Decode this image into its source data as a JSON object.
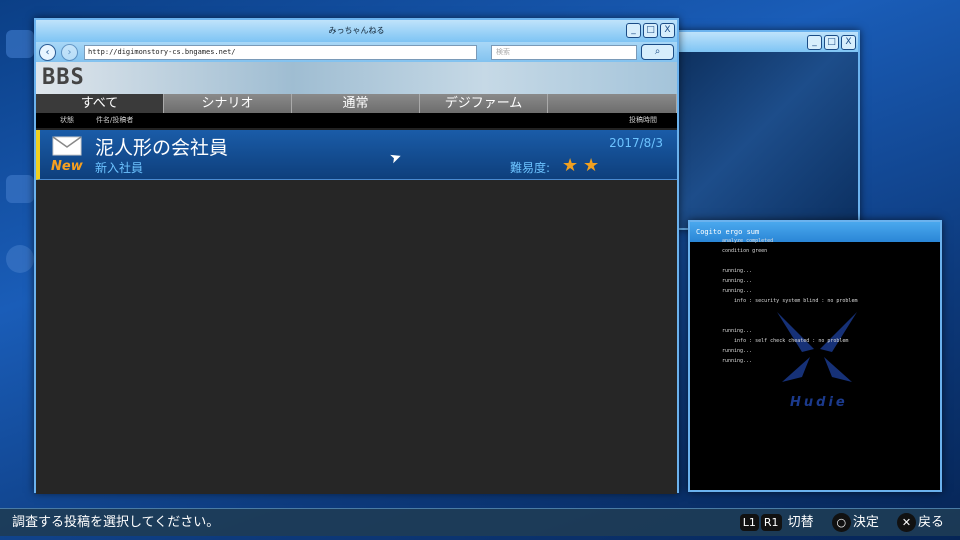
{
  "browser": {
    "title": "みっちゃんねる",
    "url": "http://digimonstory-cs.bngames.net/",
    "search_placeholder": "検索",
    "back": "‹",
    "forward": "›",
    "minimize": "_",
    "maximize": "□",
    "close": "X",
    "search_icon": "🔍"
  },
  "bbs": {
    "logo": "BBS",
    "tabs": [
      {
        "label": "すべて"
      },
      {
        "label": "シナリオ"
      },
      {
        "label": "通常"
      },
      {
        "label": "デジファーム"
      }
    ],
    "columns": {
      "status": "状態",
      "subject": "件名/投稿者",
      "time": "投稿時間"
    },
    "posts": [
      {
        "badge": "New",
        "title": "泥人形の会社員",
        "author": "新入社員",
        "date": "2017/8/3",
        "difficulty_label": "難易度:",
        "difficulty": 2,
        "icon": "mail-icon"
      }
    ]
  },
  "console": {
    "title": "Cogito ergo sum",
    "lines": "analyze completed\ncondition green\n\nrunning...\nrunning...\nrunning...\n    info : security system blind : no problem\n\n\nrunning...\n    info : self check cheated : no problem\nrunning...\nrunning...",
    "watermark": "Hudie"
  },
  "footer": {
    "prompt": "調査する投稿を選択してください。",
    "l1": "L1",
    "r1": "R1",
    "switch": "切替",
    "circle": "○",
    "confirm": "決定",
    "cross": "✕",
    "back": "戻る"
  },
  "colors": {
    "accent": "#f0d020",
    "row": "#1a5ca8"
  }
}
